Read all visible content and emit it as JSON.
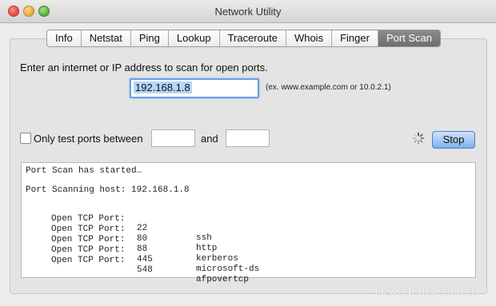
{
  "window": {
    "title": "Network Utility"
  },
  "tabs": [
    "Info",
    "Netstat",
    "Ping",
    "Lookup",
    "Traceroute",
    "Whois",
    "Finger",
    "Port Scan"
  ],
  "active_tab": "Port Scan",
  "scan": {
    "prompt": "Enter an internet or IP address to scan for open ports.",
    "address_value": "192.168.1.8",
    "hint": "(ex. www.example.com or 10.0.2.1)",
    "only_test_label": "Only test ports between",
    "and_label": "and",
    "port_from": "",
    "port_to": "",
    "stop_label": "Stop"
  },
  "output": {
    "started": "Port Scan has started…",
    "scanning": "Port Scanning host: 192.168.1.8",
    "ports": [
      {
        "label": "Open TCP Port:",
        "port": "22",
        "service": "ssh"
      },
      {
        "label": "Open TCP Port:",
        "port": "80",
        "service": "http"
      },
      {
        "label": "Open TCP Port:",
        "port": "88",
        "service": "kerberos"
      },
      {
        "label": "Open TCP Port:",
        "port": "445",
        "service": "microsoft-ds"
      },
      {
        "label": "Open TCP Port:",
        "port": "548",
        "service": "afpovertcp"
      }
    ]
  },
  "watermark": "osxdaily.com",
  "icons": {
    "spinner": "activity-spinner-icon",
    "checkbox": "checkbox-icon"
  }
}
